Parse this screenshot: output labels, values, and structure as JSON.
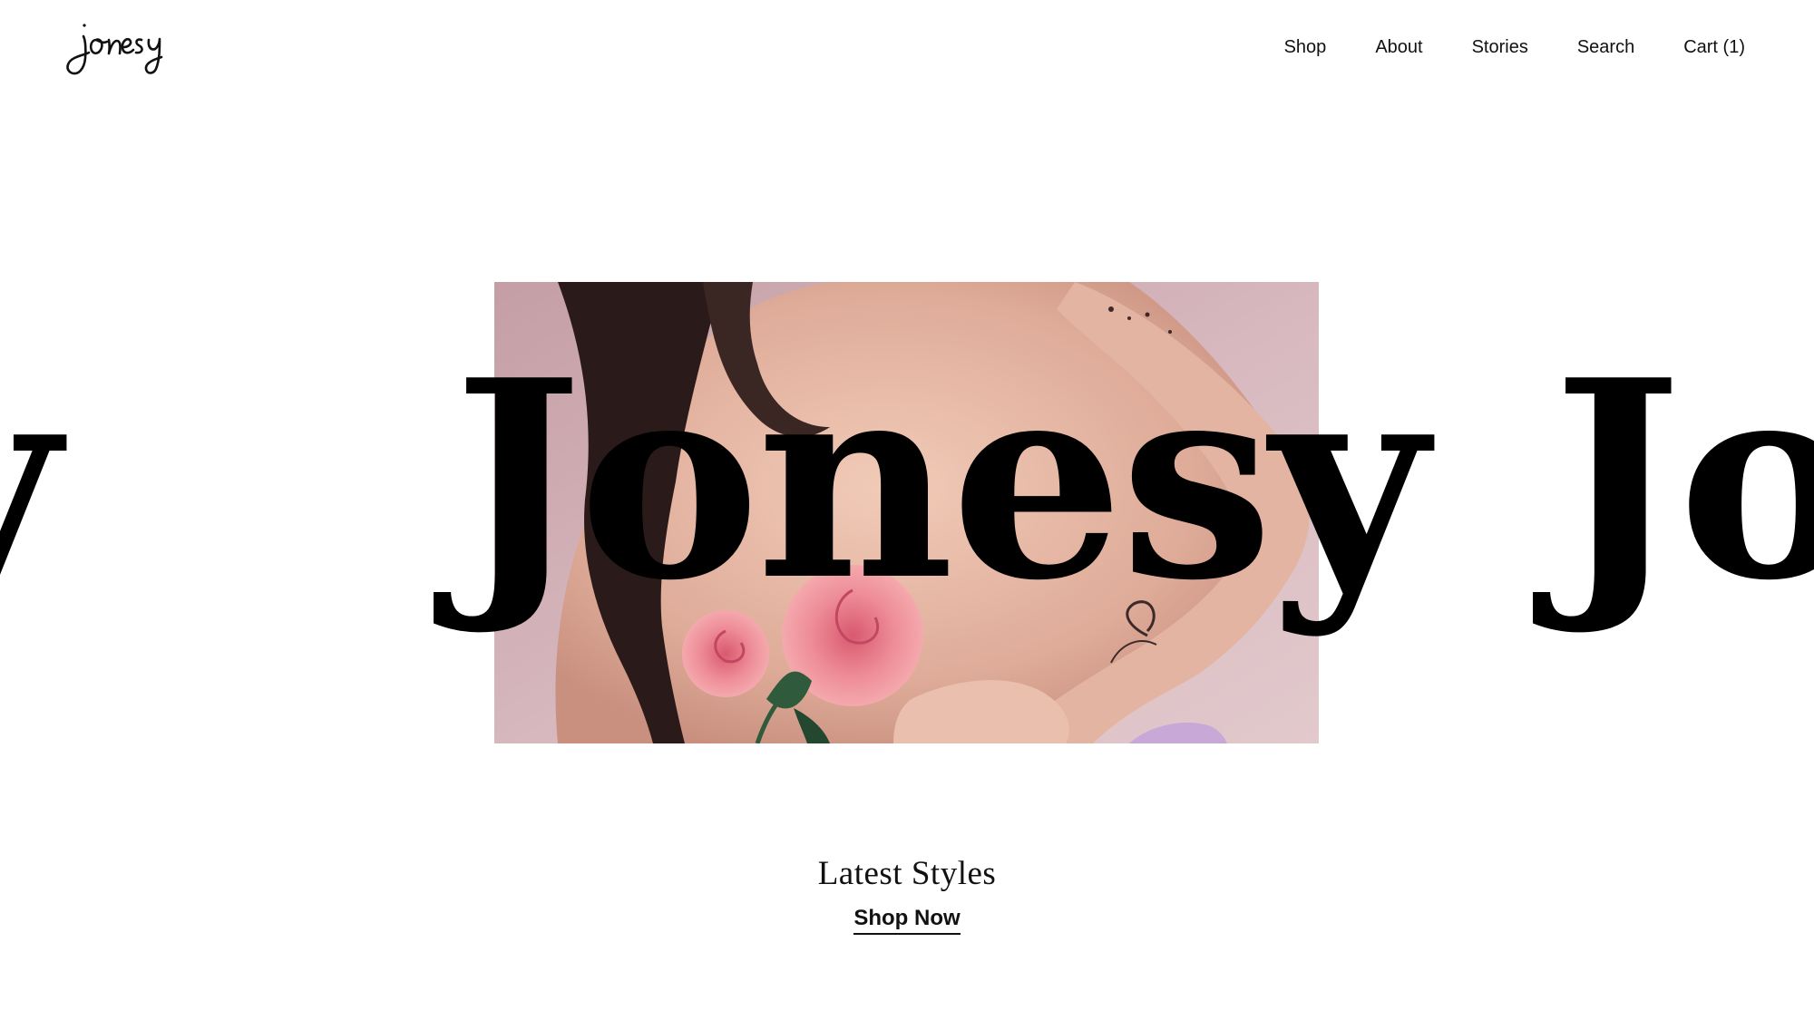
{
  "header": {
    "logo_text": "jonesy",
    "nav": [
      {
        "label": "Shop"
      },
      {
        "label": "About"
      },
      {
        "label": "Stories"
      },
      {
        "label": "Search"
      },
      {
        "label": "Cart (1)"
      }
    ]
  },
  "hero": {
    "marquee_text": "Jonesy",
    "photo_icon": "model-with-roses-photo"
  },
  "promo": {
    "title": "Latest Styles",
    "cta": "Shop Now"
  },
  "colors": {
    "background": "#ffffff",
    "text": "#111111",
    "photo_backdrop": "#d8b5bc"
  }
}
